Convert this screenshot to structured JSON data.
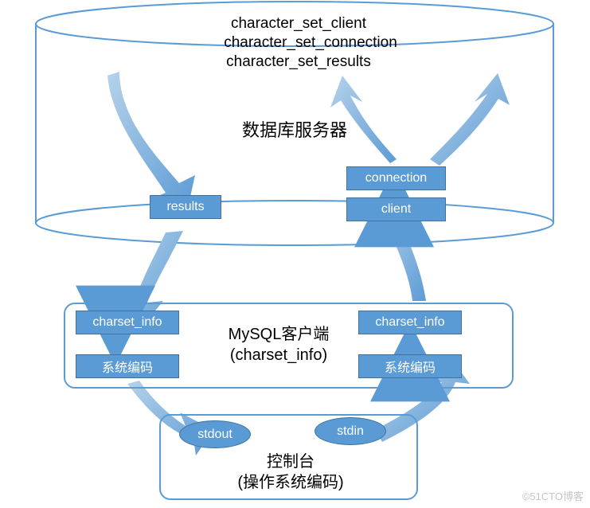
{
  "cylinder": {
    "line1": "character_set_client",
    "line2": "character_set_connection",
    "line3": "character_set_results",
    "heading": "数据库服务器"
  },
  "boxes": {
    "results": "results",
    "connection": "connection",
    "client": "client",
    "charset_left": "charset_info",
    "charset_right": "charset_info",
    "sysenc_left": "系统编码",
    "sysenc_right": "系统编码"
  },
  "panel_mid": {
    "line1": "MySQL客户端",
    "line2": "(charset_info)"
  },
  "console": {
    "stdout": "stdout",
    "stdin": "stdin",
    "line1": "控制台",
    "line2": "(操作系统编码)"
  },
  "watermark": "©51CTO博客",
  "chart_data": {
    "type": "diagram",
    "title": "MySQL character-set data flow between server, client and console",
    "nodes": [
      {
        "id": "server",
        "label": "数据库服务器",
        "sublabels": [
          "character_set_client",
          "character_set_connection",
          "character_set_results"
        ],
        "kind": "cylinder"
      },
      {
        "id": "results",
        "label": "results",
        "kind": "box",
        "parent": "server"
      },
      {
        "id": "connection",
        "label": "connection",
        "kind": "box",
        "parent": "server"
      },
      {
        "id": "client",
        "label": "client",
        "kind": "box",
        "parent": "server"
      },
      {
        "id": "mysql_client",
        "label": "MySQL客户端 (charset_info)",
        "kind": "panel"
      },
      {
        "id": "charset_left",
        "label": "charset_info",
        "kind": "box",
        "parent": "mysql_client"
      },
      {
        "id": "sysenc_left",
        "label": "系统编码",
        "kind": "box",
        "parent": "mysql_client"
      },
      {
        "id": "charset_right",
        "label": "charset_info",
        "kind": "box",
        "parent": "mysql_client"
      },
      {
        "id": "sysenc_right",
        "label": "系统编码",
        "kind": "box",
        "parent": "mysql_client"
      },
      {
        "id": "console",
        "label": "控制台 (操作系统编码)",
        "kind": "panel"
      },
      {
        "id": "stdout",
        "label": "stdout",
        "kind": "ellipse",
        "parent": "console"
      },
      {
        "id": "stdin",
        "label": "stdin",
        "kind": "ellipse",
        "parent": "console"
      }
    ],
    "edges": [
      {
        "from": "server",
        "to": "results",
        "label": "",
        "dir": "down"
      },
      {
        "from": "results",
        "to": "charset_left",
        "label": "",
        "dir": "down-curve"
      },
      {
        "from": "charset_left",
        "to": "sysenc_left",
        "label": "",
        "dir": "down"
      },
      {
        "from": "sysenc_left",
        "to": "stdout",
        "label": "",
        "dir": "down-curve"
      },
      {
        "from": "stdin",
        "to": "sysenc_right",
        "label": "",
        "dir": "up-curve"
      },
      {
        "from": "sysenc_right",
        "to": "charset_right",
        "label": "",
        "dir": "up"
      },
      {
        "from": "charset_right",
        "to": "client",
        "label": "",
        "dir": "up-curve"
      },
      {
        "from": "client",
        "to": "connection",
        "label": "",
        "dir": "up"
      },
      {
        "from": "connection",
        "to": "server",
        "label": "",
        "dir": "up-diverge",
        "note": "two outgoing arrows"
      }
    ]
  }
}
